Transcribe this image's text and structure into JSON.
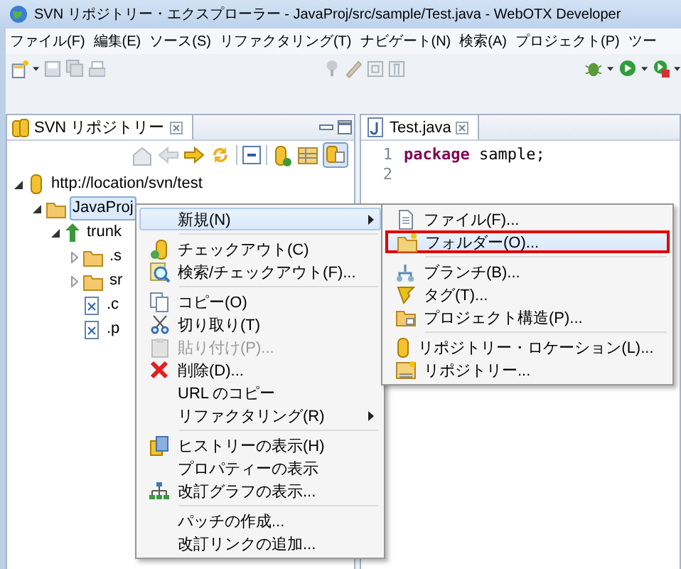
{
  "window": {
    "title": "SVN リポジトリー・エクスプローラー - JavaProj/src/sample/Test.java - WebOTX Developer"
  },
  "menu_bar": [
    "ファイル(F)",
    "編集(E)",
    "ソース(S)",
    "リファクタリング(T)",
    "ナビゲート(N)",
    "検索(A)",
    "プロジェクト(P)",
    "ツー"
  ],
  "repository_view": {
    "title": "SVN リポジトリー",
    "tree": [
      {
        "label": "http://location/svn/test",
        "expanded": true,
        "selected": false,
        "children": [
          {
            "label": "JavaProj",
            "expanded": true,
            "selected": true,
            "children": [
              {
                "label": "trunk",
                "expanded": true,
                "selected": false,
                "children": [
                  {
                    "label": ".s",
                    "expanded": false,
                    "selected": false
                  },
                  {
                    "label": "sr",
                    "expanded": false,
                    "selected": false
                  },
                  {
                    "label": ".c",
                    "selected": false
                  },
                  {
                    "label": ".p",
                    "selected": false
                  }
                ]
              }
            ]
          }
        ]
      }
    ]
  },
  "editor": {
    "tab": {
      "label": "Test.java"
    },
    "lines": [
      {
        "number": "1",
        "tokens": [
          {
            "text": "package",
            "kind": "keyword"
          },
          {
            "text": " sample;",
            "kind": "plain"
          }
        ]
      },
      {
        "number": "2"
      }
    ]
  },
  "context_menu": {
    "items": [
      {
        "kind": "item",
        "label": "新規(N)",
        "submenu": true,
        "selected": true,
        "disabled": false
      },
      {
        "kind": "separator"
      },
      {
        "kind": "item",
        "label": "チェックアウト(C)",
        "submenu": false,
        "selected": false,
        "disabled": false
      },
      {
        "kind": "item",
        "label": "検索/チェックアウト(F)...",
        "submenu": false,
        "selected": false,
        "disabled": false
      },
      {
        "kind": "separator"
      },
      {
        "kind": "item",
        "label": "コピー(O)",
        "submenu": false,
        "selected": false,
        "disabled": false
      },
      {
        "kind": "item",
        "label": "切り取り(T)",
        "submenu": false,
        "selected": false,
        "disabled": false
      },
      {
        "kind": "item",
        "label": "貼り付け(P)...",
        "submenu": false,
        "selected": false,
        "disabled": true
      },
      {
        "kind": "item",
        "label": "削除(D)...",
        "submenu": false,
        "selected": false,
        "disabled": false
      },
      {
        "kind": "item",
        "label": "URL のコピー",
        "submenu": false,
        "selected": false,
        "disabled": false
      },
      {
        "kind": "item",
        "label": "リファクタリング(R)",
        "submenu": true,
        "selected": false,
        "disabled": false
      },
      {
        "kind": "separator"
      },
      {
        "kind": "item",
        "label": "ヒストリーの表示(H)",
        "submenu": false,
        "selected": false,
        "disabled": false
      },
      {
        "kind": "item",
        "label": "プロパティーの表示",
        "submenu": false,
        "selected": false,
        "disabled": false
      },
      {
        "kind": "item",
        "label": "改訂グラフの表示...",
        "submenu": false,
        "selected": false,
        "disabled": false
      },
      {
        "kind": "separator"
      },
      {
        "kind": "item",
        "label": "パッチの作成...",
        "submenu": false,
        "selected": false,
        "disabled": false
      },
      {
        "kind": "item",
        "label": "改訂リンクの追加...",
        "submenu": false,
        "selected": false,
        "disabled": false
      }
    ]
  },
  "submenu": {
    "items": [
      {
        "kind": "item",
        "label": "ファイル(F)...",
        "selected": false
      },
      {
        "kind": "item",
        "label": "フォルダー(O)...",
        "selected": true
      },
      {
        "kind": "separator"
      },
      {
        "kind": "item",
        "label": "ブランチ(B)...",
        "selected": false
      },
      {
        "kind": "item",
        "label": "タグ(T)...",
        "selected": false
      },
      {
        "kind": "item",
        "label": "プロジェクト構造(P)...",
        "selected": false
      },
      {
        "kind": "separator"
      },
      {
        "kind": "item",
        "label": "リポジトリー・ロケーション(L)...",
        "selected": false
      },
      {
        "kind": "item",
        "label": "リポジトリー...",
        "selected": false
      }
    ]
  }
}
